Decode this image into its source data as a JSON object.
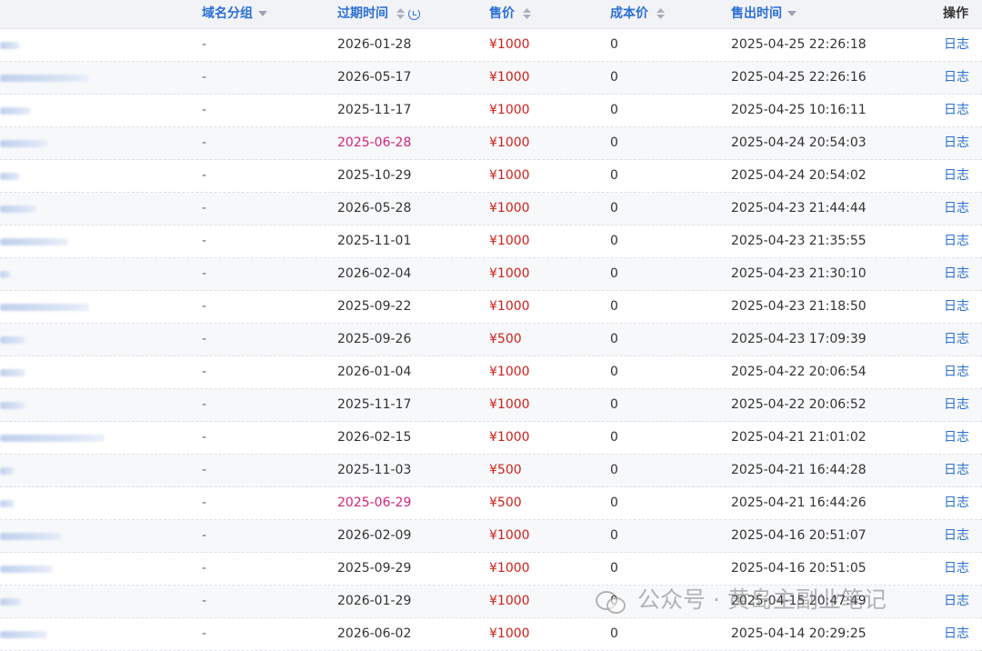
{
  "header": {
    "group": "域名分组",
    "expiry": "过期时间",
    "price": "售价",
    "cost": "成本价",
    "sold_time": "售出时间",
    "operation": "操作"
  },
  "colors": {
    "link": "#2a6fd6",
    "price": "#d0211c",
    "expiring_soon": "#d4237a",
    "header_bg": "#f2f3f7"
  },
  "rows": [
    {
      "group": "-",
      "expiry": "2026-01-28",
      "price": "¥1000",
      "cost": "0",
      "sold": "2025-04-25 22:26:18",
      "log": "日志",
      "soon": false
    },
    {
      "group": "-",
      "expiry": "2026-05-17",
      "price": "¥1000",
      "cost": "0",
      "sold": "2025-04-25 22:26:16",
      "log": "日志",
      "soon": false
    },
    {
      "group": "-",
      "expiry": "2025-11-17",
      "price": "¥1000",
      "cost": "0",
      "sold": "2025-04-25 10:16:11",
      "log": "日志",
      "soon": false
    },
    {
      "group": "-",
      "expiry": "2025-06-28",
      "price": "¥1000",
      "cost": "0",
      "sold": "2025-04-24 20:54:03",
      "log": "日志",
      "soon": true
    },
    {
      "group": "-",
      "expiry": "2025-10-29",
      "price": "¥1000",
      "cost": "0",
      "sold": "2025-04-24 20:54:02",
      "log": "日志",
      "soon": false
    },
    {
      "group": "-",
      "expiry": "2026-05-28",
      "price": "¥1000",
      "cost": "0",
      "sold": "2025-04-23 21:44:44",
      "log": "日志",
      "soon": false
    },
    {
      "group": "-",
      "expiry": "2025-11-01",
      "price": "¥1000",
      "cost": "0",
      "sold": "2025-04-23 21:35:55",
      "log": "日志",
      "soon": false
    },
    {
      "group": "-",
      "expiry": "2026-02-04",
      "price": "¥1000",
      "cost": "0",
      "sold": "2025-04-23 21:30:10",
      "log": "日志",
      "soon": false
    },
    {
      "group": "-",
      "expiry": "2025-09-22",
      "price": "¥1000",
      "cost": "0",
      "sold": "2025-04-23 21:18:50",
      "log": "日志",
      "soon": false
    },
    {
      "group": "-",
      "expiry": "2025-09-26",
      "price": "¥500",
      "cost": "0",
      "sold": "2025-04-23 17:09:39",
      "log": "日志",
      "soon": false
    },
    {
      "group": "-",
      "expiry": "2026-01-04",
      "price": "¥1000",
      "cost": "0",
      "sold": "2025-04-22 20:06:54",
      "log": "日志",
      "soon": false
    },
    {
      "group": "-",
      "expiry": "2025-11-17",
      "price": "¥1000",
      "cost": "0",
      "sold": "2025-04-22 20:06:52",
      "log": "日志",
      "soon": false
    },
    {
      "group": "-",
      "expiry": "2026-02-15",
      "price": "¥1000",
      "cost": "0",
      "sold": "2025-04-21 21:01:02",
      "log": "日志",
      "soon": false
    },
    {
      "group": "-",
      "expiry": "2025-11-03",
      "price": "¥500",
      "cost": "0",
      "sold": "2025-04-21 16:44:28",
      "log": "日志",
      "soon": false
    },
    {
      "group": "-",
      "expiry": "2025-06-29",
      "price": "¥500",
      "cost": "0",
      "sold": "2025-04-21 16:44:26",
      "log": "日志",
      "soon": true
    },
    {
      "group": "-",
      "expiry": "2026-02-09",
      "price": "¥1000",
      "cost": "0",
      "sold": "2025-04-16 20:51:07",
      "log": "日志",
      "soon": false
    },
    {
      "group": "-",
      "expiry": "2025-09-29",
      "price": "¥1000",
      "cost": "0",
      "sold": "2025-04-16 20:51:05",
      "log": "日志",
      "soon": false
    },
    {
      "group": "-",
      "expiry": "2026-01-29",
      "price": "¥1000",
      "cost": "0",
      "sold": "2025-04-15 20:47:49",
      "log": "日志",
      "soon": false
    },
    {
      "group": "-",
      "expiry": "2026-06-02",
      "price": "¥1000",
      "cost": "0",
      "sold": "2025-04-14 20:29:25",
      "log": "日志",
      "soon": false
    }
  ],
  "watermark": {
    "icon": "wechat-icon",
    "text": "公众号 · 黄岛主副业笔记"
  }
}
